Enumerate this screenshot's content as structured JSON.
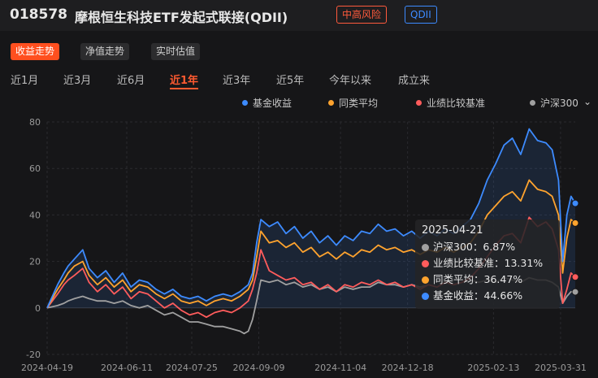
{
  "header": {
    "fund_code": "018578",
    "fund_name": "摩根恒生科技ETF发起式联接(QDII)",
    "risk_badge": "中高风险",
    "type_badge": "QDII"
  },
  "view_tabs": [
    {
      "label": "收益走势",
      "active": true
    },
    {
      "label": "净值走势",
      "active": false
    },
    {
      "label": "实时估值",
      "active": false
    }
  ],
  "periods": [
    {
      "label": "近1月",
      "active": false
    },
    {
      "label": "近3月",
      "active": false
    },
    {
      "label": "近6月",
      "active": false
    },
    {
      "label": "近1年",
      "active": true
    },
    {
      "label": "近3年",
      "active": false
    },
    {
      "label": "近5年",
      "active": false
    },
    {
      "label": "今年以来",
      "active": false
    },
    {
      "label": "成立来",
      "active": false
    }
  ],
  "colors": {
    "fund": "#3d8bff",
    "peer": "#ffa32e",
    "benchmark": "#ff5c5c",
    "hs300": "#a0a0a0",
    "accent": "#ff4f1f"
  },
  "tooltip": {
    "date": "2025-04-21",
    "rows": [
      {
        "label": "沪深300：6.87%",
        "color": "#a0a0a0"
      },
      {
        "label": "业绩比较基准：13.31%",
        "color": "#ff5c5c"
      },
      {
        "label": "同类平均：36.47%",
        "color": "#ffa32e"
      },
      {
        "label": "基金收益：44.66%",
        "color": "#3d8bff"
      }
    ]
  },
  "chart_data": {
    "type": "line",
    "title": "",
    "xlabel": "",
    "ylabel": "",
    "ylim": [
      -20,
      80
    ],
    "yticks": [
      -20,
      0,
      20,
      40,
      60,
      80
    ],
    "x_tick_labels": [
      "2024-04-19",
      "2024-06-11",
      "2024-07-25",
      "2024-09-09",
      "2024-11-04",
      "2024-12-18",
      "2025-02-13",
      "2025-03-31"
    ],
    "x_tick_positions": [
      0,
      38,
      69,
      101,
      140,
      172,
      213,
      245
    ],
    "x_end": 252,
    "legend_position": "top-right",
    "grid": true,
    "series": [
      {
        "name": "基金收益",
        "color": "#3d8bff",
        "points": [
          [
            0,
            0
          ],
          [
            5,
            10
          ],
          [
            8,
            15
          ],
          [
            10,
            18
          ],
          [
            13,
            21
          ],
          [
            17,
            25
          ],
          [
            20,
            17
          ],
          [
            24,
            13
          ],
          [
            28,
            16
          ],
          [
            32,
            11
          ],
          [
            36,
            15
          ],
          [
            40,
            9
          ],
          [
            44,
            12
          ],
          [
            48,
            11
          ],
          [
            52,
            8
          ],
          [
            56,
            6
          ],
          [
            60,
            8
          ],
          [
            64,
            5
          ],
          [
            68,
            4
          ],
          [
            72,
            5
          ],
          [
            76,
            3
          ],
          [
            80,
            5
          ],
          [
            84,
            6
          ],
          [
            88,
            5
          ],
          [
            92,
            7
          ],
          [
            96,
            10
          ],
          [
            98,
            15
          ],
          [
            100,
            28
          ],
          [
            102,
            38
          ],
          [
            106,
            35
          ],
          [
            110,
            37
          ],
          [
            114,
            32
          ],
          [
            118,
            35
          ],
          [
            122,
            30
          ],
          [
            126,
            33
          ],
          [
            130,
            28
          ],
          [
            134,
            31
          ],
          [
            138,
            27
          ],
          [
            142,
            31
          ],
          [
            146,
            29
          ],
          [
            150,
            33
          ],
          [
            154,
            32
          ],
          [
            158,
            36
          ],
          [
            162,
            33
          ],
          [
            166,
            34
          ],
          [
            170,
            31
          ],
          [
            174,
            33
          ],
          [
            178,
            30
          ],
          [
            182,
            33
          ],
          [
            186,
            31
          ],
          [
            190,
            34
          ],
          [
            194,
            32
          ],
          [
            198,
            35
          ],
          [
            202,
            38
          ],
          [
            206,
            45
          ],
          [
            210,
            55
          ],
          [
            214,
            62
          ],
          [
            218,
            70
          ],
          [
            222,
            73
          ],
          [
            226,
            66
          ],
          [
            230,
            77
          ],
          [
            234,
            72
          ],
          [
            238,
            71
          ],
          [
            241,
            68
          ],
          [
            244,
            55
          ],
          [
            246,
            20
          ],
          [
            248,
            40
          ],
          [
            250,
            48
          ],
          [
            252,
            45
          ]
        ]
      },
      {
        "name": "同类平均",
        "color": "#ffa32e",
        "points": [
          [
            0,
            0
          ],
          [
            5,
            8
          ],
          [
            8,
            12
          ],
          [
            10,
            15
          ],
          [
            13,
            18
          ],
          [
            17,
            20
          ],
          [
            20,
            14
          ],
          [
            24,
            10
          ],
          [
            28,
            13
          ],
          [
            32,
            9
          ],
          [
            36,
            12
          ],
          [
            40,
            7
          ],
          [
            44,
            10
          ],
          [
            48,
            9
          ],
          [
            52,
            6
          ],
          [
            56,
            4
          ],
          [
            60,
            6
          ],
          [
            64,
            3
          ],
          [
            68,
            2
          ],
          [
            72,
            3
          ],
          [
            76,
            1
          ],
          [
            80,
            3
          ],
          [
            84,
            4
          ],
          [
            88,
            3
          ],
          [
            92,
            5
          ],
          [
            96,
            8
          ],
          [
            98,
            12
          ],
          [
            100,
            22
          ],
          [
            102,
            33
          ],
          [
            106,
            28
          ],
          [
            110,
            29
          ],
          [
            114,
            26
          ],
          [
            118,
            28
          ],
          [
            122,
            24
          ],
          [
            126,
            26
          ],
          [
            130,
            22
          ],
          [
            134,
            24
          ],
          [
            138,
            21
          ],
          [
            142,
            24
          ],
          [
            146,
            22
          ],
          [
            150,
            25
          ],
          [
            154,
            24
          ],
          [
            158,
            27
          ],
          [
            162,
            25
          ],
          [
            166,
            26
          ],
          [
            170,
            24
          ],
          [
            174,
            25
          ],
          [
            178,
            23
          ],
          [
            182,
            25
          ],
          [
            186,
            24
          ],
          [
            190,
            26
          ],
          [
            194,
            24
          ],
          [
            198,
            26
          ],
          [
            202,
            28
          ],
          [
            206,
            33
          ],
          [
            210,
            40
          ],
          [
            214,
            44
          ],
          [
            218,
            48
          ],
          [
            222,
            50
          ],
          [
            226,
            46
          ],
          [
            230,
            55
          ],
          [
            234,
            51
          ],
          [
            238,
            50
          ],
          [
            241,
            48
          ],
          [
            244,
            40
          ],
          [
            246,
            15
          ],
          [
            248,
            30
          ],
          [
            250,
            38
          ],
          [
            252,
            36.5
          ]
        ]
      },
      {
        "name": "业绩比较基准",
        "color": "#ff5c5c",
        "points": [
          [
            0,
            0
          ],
          [
            5,
            6
          ],
          [
            8,
            10
          ],
          [
            10,
            12
          ],
          [
            13,
            14
          ],
          [
            17,
            17
          ],
          [
            20,
            11
          ],
          [
            24,
            7
          ],
          [
            28,
            10
          ],
          [
            32,
            6
          ],
          [
            36,
            9
          ],
          [
            40,
            4
          ],
          [
            44,
            7
          ],
          [
            48,
            6
          ],
          [
            52,
            3
          ],
          [
            56,
            0
          ],
          [
            60,
            2
          ],
          [
            64,
            -1
          ],
          [
            68,
            -3
          ],
          [
            72,
            -2
          ],
          [
            76,
            -4
          ],
          [
            80,
            -2
          ],
          [
            84,
            -1
          ],
          [
            88,
            -2
          ],
          [
            92,
            0
          ],
          [
            96,
            3
          ],
          [
            98,
            8
          ],
          [
            100,
            15
          ],
          [
            102,
            25
          ],
          [
            106,
            16
          ],
          [
            110,
            14
          ],
          [
            114,
            12
          ],
          [
            118,
            13
          ],
          [
            122,
            10
          ],
          [
            126,
            11
          ],
          [
            130,
            8
          ],
          [
            134,
            10
          ],
          [
            138,
            7
          ],
          [
            142,
            10
          ],
          [
            146,
            9
          ],
          [
            150,
            11
          ],
          [
            154,
            10
          ],
          [
            158,
            12
          ],
          [
            162,
            10
          ],
          [
            166,
            11
          ],
          [
            170,
            9
          ],
          [
            174,
            10
          ],
          [
            178,
            8
          ],
          [
            182,
            10
          ],
          [
            186,
            9
          ],
          [
            190,
            11
          ],
          [
            194,
            10
          ],
          [
            198,
            11
          ],
          [
            202,
            13
          ],
          [
            206,
            17
          ],
          [
            210,
            22
          ],
          [
            214,
            27
          ],
          [
            218,
            31
          ],
          [
            222,
            32
          ],
          [
            226,
            28
          ],
          [
            230,
            39
          ],
          [
            234,
            35
          ],
          [
            238,
            37
          ],
          [
            241,
            34
          ],
          [
            244,
            25
          ],
          [
            246,
            2
          ],
          [
            248,
            8
          ],
          [
            250,
            15
          ],
          [
            252,
            13.3
          ]
        ]
      },
      {
        "name": "沪深300",
        "color": "#a0a0a0",
        "points": [
          [
            0,
            0
          ],
          [
            5,
            1
          ],
          [
            8,
            2
          ],
          [
            10,
            3
          ],
          [
            13,
            4
          ],
          [
            17,
            5
          ],
          [
            20,
            4
          ],
          [
            24,
            3
          ],
          [
            28,
            3
          ],
          [
            32,
            2
          ],
          [
            36,
            3
          ],
          [
            40,
            1
          ],
          [
            44,
            0
          ],
          [
            48,
            1
          ],
          [
            52,
            -1
          ],
          [
            56,
            -3
          ],
          [
            60,
            -2
          ],
          [
            64,
            -4
          ],
          [
            68,
            -6
          ],
          [
            72,
            -6
          ],
          [
            76,
            -7
          ],
          [
            80,
            -8
          ],
          [
            84,
            -8
          ],
          [
            88,
            -9
          ],
          [
            92,
            -10
          ],
          [
            94,
            -11
          ],
          [
            96,
            -10
          ],
          [
            98,
            -5
          ],
          [
            100,
            3
          ],
          [
            102,
            12
          ],
          [
            106,
            11
          ],
          [
            110,
            12
          ],
          [
            114,
            10
          ],
          [
            118,
            11
          ],
          [
            122,
            9
          ],
          [
            126,
            10
          ],
          [
            130,
            8
          ],
          [
            134,
            9
          ],
          [
            138,
            7
          ],
          [
            142,
            9
          ],
          [
            146,
            8
          ],
          [
            150,
            9
          ],
          [
            154,
            9
          ],
          [
            158,
            11
          ],
          [
            162,
            10
          ],
          [
            166,
            10
          ],
          [
            170,
            9
          ],
          [
            174,
            10
          ],
          [
            178,
            9
          ],
          [
            182,
            10
          ],
          [
            186,
            9
          ],
          [
            190,
            11
          ],
          [
            194,
            10
          ],
          [
            198,
            11
          ],
          [
            202,
            12
          ],
          [
            206,
            11
          ],
          [
            210,
            12
          ],
          [
            214,
            11
          ],
          [
            218,
            13
          ],
          [
            222,
            12
          ],
          [
            226,
            11
          ],
          [
            230,
            13
          ],
          [
            234,
            12
          ],
          [
            238,
            12
          ],
          [
            241,
            11
          ],
          [
            244,
            9
          ],
          [
            246,
            2
          ],
          [
            248,
            5
          ],
          [
            250,
            7
          ],
          [
            252,
            6.9
          ]
        ]
      }
    ]
  }
}
